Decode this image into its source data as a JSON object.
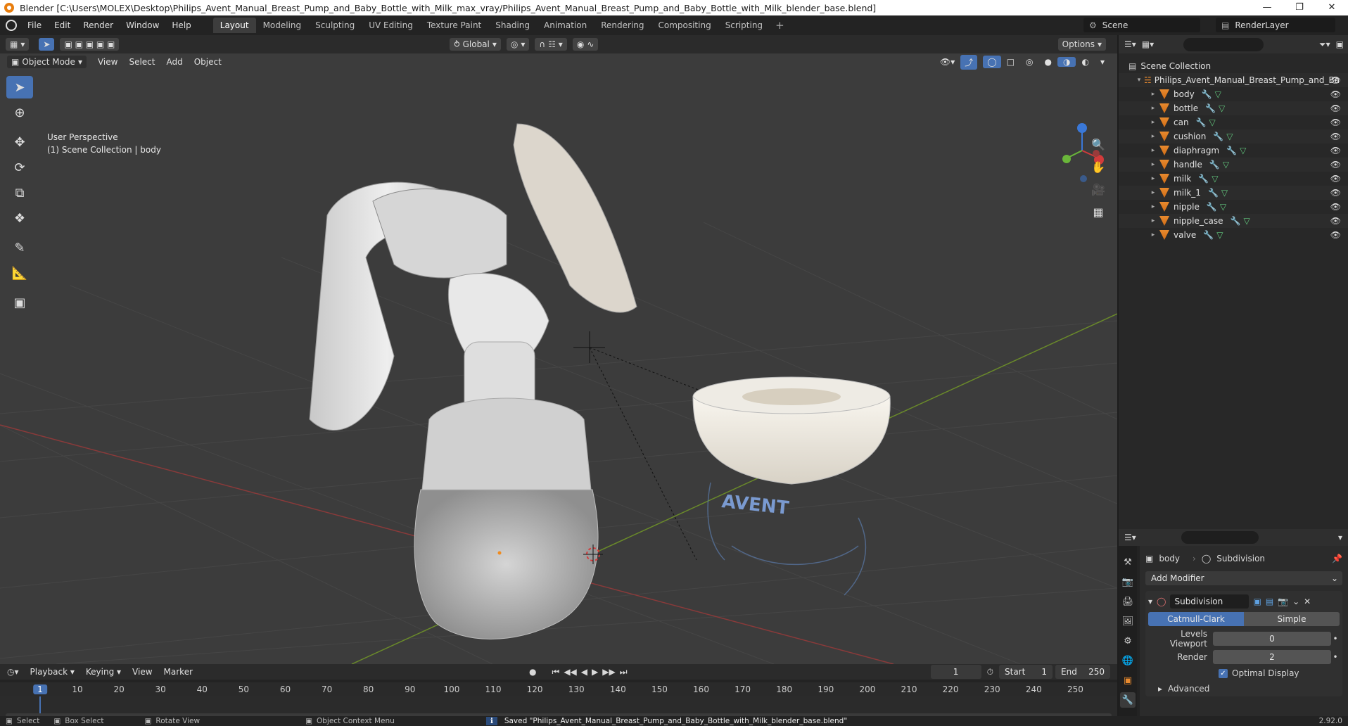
{
  "window": {
    "title": "Blender [C:\\Users\\MOLEX\\Desktop\\Philips_Avent_Manual_Breast_Pump_and_Baby_Bottle_with_Milk_max_vray/Philips_Avent_Manual_Breast_Pump_and_Baby_Bottle_with_Milk_blender_base.blend]"
  },
  "menu": [
    "File",
    "Edit",
    "Render",
    "Window",
    "Help"
  ],
  "workspaces": [
    "Layout",
    "Modeling",
    "Sculpting",
    "UV Editing",
    "Texture Paint",
    "Shading",
    "Animation",
    "Rendering",
    "Compositing",
    "Scripting"
  ],
  "active_workspace": "Layout",
  "scene": {
    "name": "Scene",
    "render_layer": "RenderLayer"
  },
  "viewport": {
    "mode": "Object Mode",
    "menus": [
      "View",
      "Select",
      "Add",
      "Object"
    ],
    "transform_orientation": "Global",
    "options_label": "Options",
    "perspective": "User Perspective",
    "collection_info": "(1) Scene Collection | body",
    "logo_text": "AVENT"
  },
  "outliner": {
    "root": "Scene Collection",
    "collection": "Philips_Avent_Manual_Breast_Pump_and_Ba",
    "objects": [
      "body",
      "bottle",
      "can",
      "cushion",
      "diaphragm",
      "handle",
      "milk",
      "milk_1",
      "nipple",
      "nipple_case",
      "valve"
    ]
  },
  "properties": {
    "object": "body",
    "modifier_tab": "Subdivision",
    "add_modifier": "Add Modifier",
    "modifier_name": "Subdivision",
    "algorithms": [
      "Catmull-Clark",
      "Simple"
    ],
    "active_algorithm": "Catmull-Clark",
    "levels_viewport_label": "Levels Viewport",
    "levels_viewport": "0",
    "render_label": "Render",
    "render": "2",
    "optimal_display": "Optimal Display",
    "advanced": "Advanced"
  },
  "timeline": {
    "menus": [
      "Playback",
      "Keying",
      "View",
      "Marker"
    ],
    "current_frame": "1",
    "start_label": "Start",
    "start": "1",
    "end_label": "End",
    "end": "250",
    "ticks": [
      "1",
      "10",
      "20",
      "30",
      "40",
      "50",
      "60",
      "70",
      "80",
      "90",
      "100",
      "110",
      "120",
      "130",
      "140",
      "150",
      "160",
      "170",
      "180",
      "190",
      "200",
      "210",
      "220",
      "230",
      "240",
      "250"
    ]
  },
  "statusbar": {
    "select": "Select",
    "box_select": "Box Select",
    "rotate": "Rotate View",
    "context": "Object Context Menu",
    "message": "Saved \"Philips_Avent_Manual_Breast_Pump_and_Baby_Bottle_with_Milk_blender_base.blend\"",
    "version": "2.92.0"
  }
}
